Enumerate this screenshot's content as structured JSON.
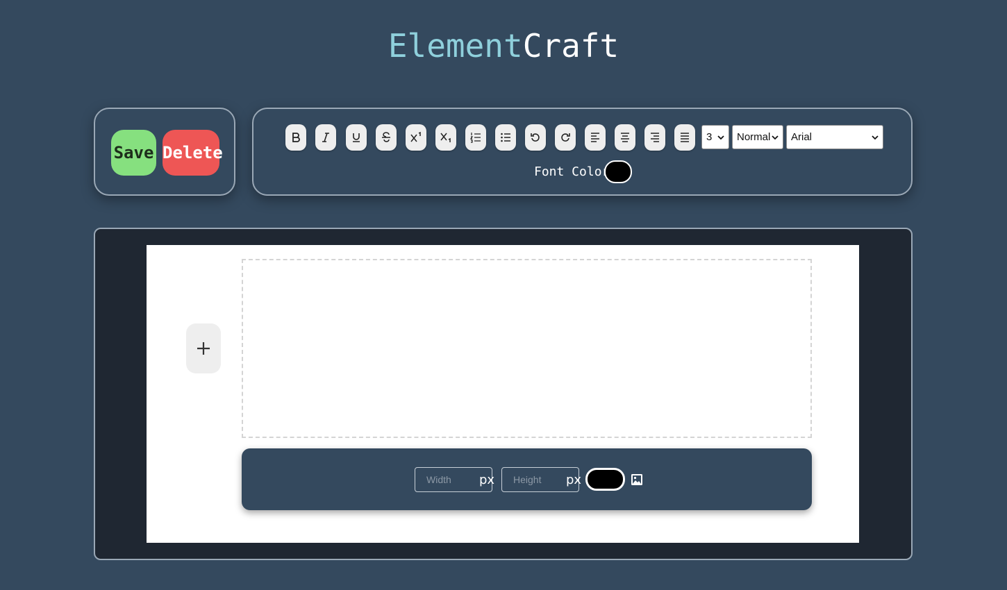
{
  "app": {
    "title_part1": "Element",
    "title_part2": "Craft"
  },
  "actions": {
    "save_label": "Save",
    "delete_label": "Delete"
  },
  "toolbar": {
    "buttons": [
      {
        "name": "bold",
        "icon": "bold-icon"
      },
      {
        "name": "italic",
        "icon": "italic-icon"
      },
      {
        "name": "underline",
        "icon": "underline-icon"
      },
      {
        "name": "strikethrough",
        "icon": "strikethrough-icon"
      },
      {
        "name": "superscript",
        "icon": "superscript-icon"
      },
      {
        "name": "subscript",
        "icon": "subscript-icon"
      },
      {
        "name": "ordered-list",
        "icon": "ordered-list-icon"
      },
      {
        "name": "unordered-list",
        "icon": "unordered-list-icon"
      },
      {
        "name": "undo",
        "icon": "undo-icon"
      },
      {
        "name": "redo",
        "icon": "redo-icon"
      },
      {
        "name": "align-left",
        "icon": "align-left-icon"
      },
      {
        "name": "align-center",
        "icon": "align-center-icon"
      },
      {
        "name": "align-right",
        "icon": "align-right-icon"
      },
      {
        "name": "justify",
        "icon": "align-justify-icon"
      }
    ],
    "font_size_value": "3",
    "heading_value": "Normal",
    "font_family_value": "Arial",
    "font_color_label": "Font Color",
    "font_color": "#000000"
  },
  "element_toolbar": {
    "width_placeholder": "Width",
    "height_placeholder": "Height",
    "unit": "px",
    "bg_color": "#000000",
    "image_icon": "image-icon"
  },
  "canvas": {
    "add_icon": "plus-icon"
  },
  "colors": {
    "background": "#34495e",
    "save": "#86e07f",
    "delete": "#ee5655",
    "canvas_bg": "#1f2732"
  }
}
